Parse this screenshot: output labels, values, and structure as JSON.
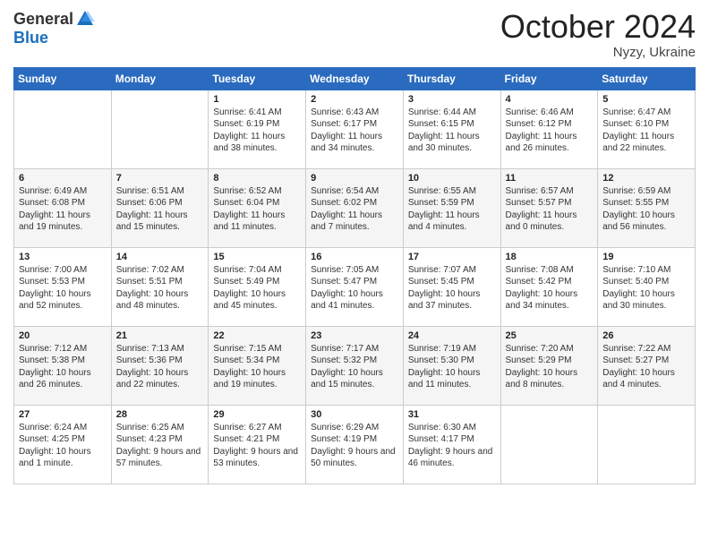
{
  "logo": {
    "general": "General",
    "blue": "Blue"
  },
  "title": "October 2024",
  "location": "Nyzy, Ukraine",
  "days_of_week": [
    "Sunday",
    "Monday",
    "Tuesday",
    "Wednesday",
    "Thursday",
    "Friday",
    "Saturday"
  ],
  "weeks": [
    [
      {
        "day": "",
        "info": ""
      },
      {
        "day": "",
        "info": ""
      },
      {
        "day": "1",
        "info": "Sunrise: 6:41 AM\nSunset: 6:19 PM\nDaylight: 11 hours and 38 minutes."
      },
      {
        "day": "2",
        "info": "Sunrise: 6:43 AM\nSunset: 6:17 PM\nDaylight: 11 hours and 34 minutes."
      },
      {
        "day": "3",
        "info": "Sunrise: 6:44 AM\nSunset: 6:15 PM\nDaylight: 11 hours and 30 minutes."
      },
      {
        "day": "4",
        "info": "Sunrise: 6:46 AM\nSunset: 6:12 PM\nDaylight: 11 hours and 26 minutes."
      },
      {
        "day": "5",
        "info": "Sunrise: 6:47 AM\nSunset: 6:10 PM\nDaylight: 11 hours and 22 minutes."
      }
    ],
    [
      {
        "day": "6",
        "info": "Sunrise: 6:49 AM\nSunset: 6:08 PM\nDaylight: 11 hours and 19 minutes."
      },
      {
        "day": "7",
        "info": "Sunrise: 6:51 AM\nSunset: 6:06 PM\nDaylight: 11 hours and 15 minutes."
      },
      {
        "day": "8",
        "info": "Sunrise: 6:52 AM\nSunset: 6:04 PM\nDaylight: 11 hours and 11 minutes."
      },
      {
        "day": "9",
        "info": "Sunrise: 6:54 AM\nSunset: 6:02 PM\nDaylight: 11 hours and 7 minutes."
      },
      {
        "day": "10",
        "info": "Sunrise: 6:55 AM\nSunset: 5:59 PM\nDaylight: 11 hours and 4 minutes."
      },
      {
        "day": "11",
        "info": "Sunrise: 6:57 AM\nSunset: 5:57 PM\nDaylight: 11 hours and 0 minutes."
      },
      {
        "day": "12",
        "info": "Sunrise: 6:59 AM\nSunset: 5:55 PM\nDaylight: 10 hours and 56 minutes."
      }
    ],
    [
      {
        "day": "13",
        "info": "Sunrise: 7:00 AM\nSunset: 5:53 PM\nDaylight: 10 hours and 52 minutes."
      },
      {
        "day": "14",
        "info": "Sunrise: 7:02 AM\nSunset: 5:51 PM\nDaylight: 10 hours and 48 minutes."
      },
      {
        "day": "15",
        "info": "Sunrise: 7:04 AM\nSunset: 5:49 PM\nDaylight: 10 hours and 45 minutes."
      },
      {
        "day": "16",
        "info": "Sunrise: 7:05 AM\nSunset: 5:47 PM\nDaylight: 10 hours and 41 minutes."
      },
      {
        "day": "17",
        "info": "Sunrise: 7:07 AM\nSunset: 5:45 PM\nDaylight: 10 hours and 37 minutes."
      },
      {
        "day": "18",
        "info": "Sunrise: 7:08 AM\nSunset: 5:42 PM\nDaylight: 10 hours and 34 minutes."
      },
      {
        "day": "19",
        "info": "Sunrise: 7:10 AM\nSunset: 5:40 PM\nDaylight: 10 hours and 30 minutes."
      }
    ],
    [
      {
        "day": "20",
        "info": "Sunrise: 7:12 AM\nSunset: 5:38 PM\nDaylight: 10 hours and 26 minutes."
      },
      {
        "day": "21",
        "info": "Sunrise: 7:13 AM\nSunset: 5:36 PM\nDaylight: 10 hours and 22 minutes."
      },
      {
        "day": "22",
        "info": "Sunrise: 7:15 AM\nSunset: 5:34 PM\nDaylight: 10 hours and 19 minutes."
      },
      {
        "day": "23",
        "info": "Sunrise: 7:17 AM\nSunset: 5:32 PM\nDaylight: 10 hours and 15 minutes."
      },
      {
        "day": "24",
        "info": "Sunrise: 7:19 AM\nSunset: 5:30 PM\nDaylight: 10 hours and 11 minutes."
      },
      {
        "day": "25",
        "info": "Sunrise: 7:20 AM\nSunset: 5:29 PM\nDaylight: 10 hours and 8 minutes."
      },
      {
        "day": "26",
        "info": "Sunrise: 7:22 AM\nSunset: 5:27 PM\nDaylight: 10 hours and 4 minutes."
      }
    ],
    [
      {
        "day": "27",
        "info": "Sunrise: 6:24 AM\nSunset: 4:25 PM\nDaylight: 10 hours and 1 minute."
      },
      {
        "day": "28",
        "info": "Sunrise: 6:25 AM\nSunset: 4:23 PM\nDaylight: 9 hours and 57 minutes."
      },
      {
        "day": "29",
        "info": "Sunrise: 6:27 AM\nSunset: 4:21 PM\nDaylight: 9 hours and 53 minutes."
      },
      {
        "day": "30",
        "info": "Sunrise: 6:29 AM\nSunset: 4:19 PM\nDaylight: 9 hours and 50 minutes."
      },
      {
        "day": "31",
        "info": "Sunrise: 6:30 AM\nSunset: 4:17 PM\nDaylight: 9 hours and 46 minutes."
      },
      {
        "day": "",
        "info": ""
      },
      {
        "day": "",
        "info": ""
      }
    ]
  ]
}
